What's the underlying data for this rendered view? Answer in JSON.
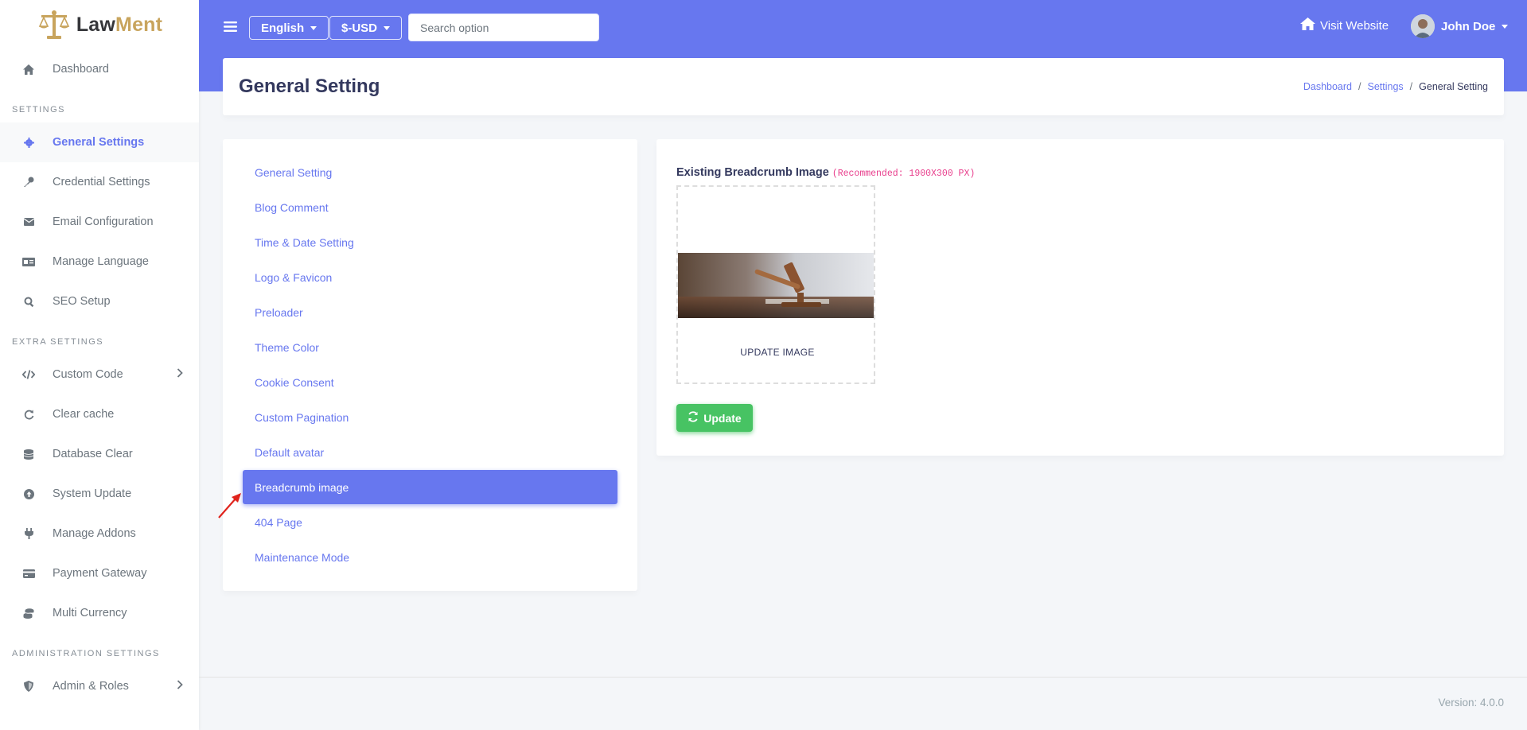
{
  "brand": {
    "name_part1": "Law",
    "name_part2": "Ment"
  },
  "sidebar": {
    "items_top": [
      {
        "label": "Dashboard",
        "icon": "home-icon"
      }
    ],
    "section_settings": "SETTINGS",
    "settings_items": [
      {
        "label": "General Settings",
        "icon": "gear-icon",
        "active": true
      },
      {
        "label": "Credential Settings",
        "icon": "key-icon"
      },
      {
        "label": "Email Configuration",
        "icon": "envelope-icon"
      },
      {
        "label": "Manage Language",
        "icon": "language-icon"
      },
      {
        "label": "SEO Setup",
        "icon": "search-icon"
      }
    ],
    "section_extra": "EXTRA SETTINGS",
    "extra_items": [
      {
        "label": "Custom Code",
        "icon": "code-icon",
        "has_submenu": true
      },
      {
        "label": "Clear cache",
        "icon": "refresh-icon"
      },
      {
        "label": "Database Clear",
        "icon": "database-icon"
      },
      {
        "label": "System Update",
        "icon": "upload-icon"
      },
      {
        "label": "Manage Addons",
        "icon": "plug-icon"
      },
      {
        "label": "Payment Gateway",
        "icon": "credit-card-icon"
      },
      {
        "label": "Multi Currency",
        "icon": "coins-icon"
      }
    ],
    "section_admin": "ADMINISTRATION SETTINGS",
    "admin_items": [
      {
        "label": "Admin & Roles",
        "icon": "shield-icon",
        "has_submenu": true
      }
    ]
  },
  "topbar": {
    "language": "English",
    "currency": "$-USD",
    "search_placeholder": "Search option",
    "visit_website": "Visit Website",
    "user_name": "John Doe"
  },
  "header": {
    "title": "General Setting",
    "breadcrumb": [
      "Dashboard",
      "Settings",
      "General Setting"
    ]
  },
  "settings_nav": {
    "items": [
      "General Setting",
      "Blog Comment",
      "Time & Date Setting",
      "Logo & Favicon",
      "Preloader",
      "Theme Color",
      "Cookie Consent",
      "Custom Pagination",
      "Default avatar",
      "Breadcrumb image",
      "404 Page",
      "Maintenance Mode"
    ],
    "active": "Breadcrumb image"
  },
  "content": {
    "label": "Existing Breadcrumb Image",
    "recommendation": "(Recommended: 1900X300 PX)",
    "update_image_label": "UPDATE IMAGE",
    "update_button": "Update"
  },
  "footer": {
    "version": "Version: 4.0.0"
  },
  "colors": {
    "primary": "#6777ef",
    "success": "#47c363",
    "brand_gold": "#c8a45d",
    "recommend_pink": "#e83e8c"
  }
}
